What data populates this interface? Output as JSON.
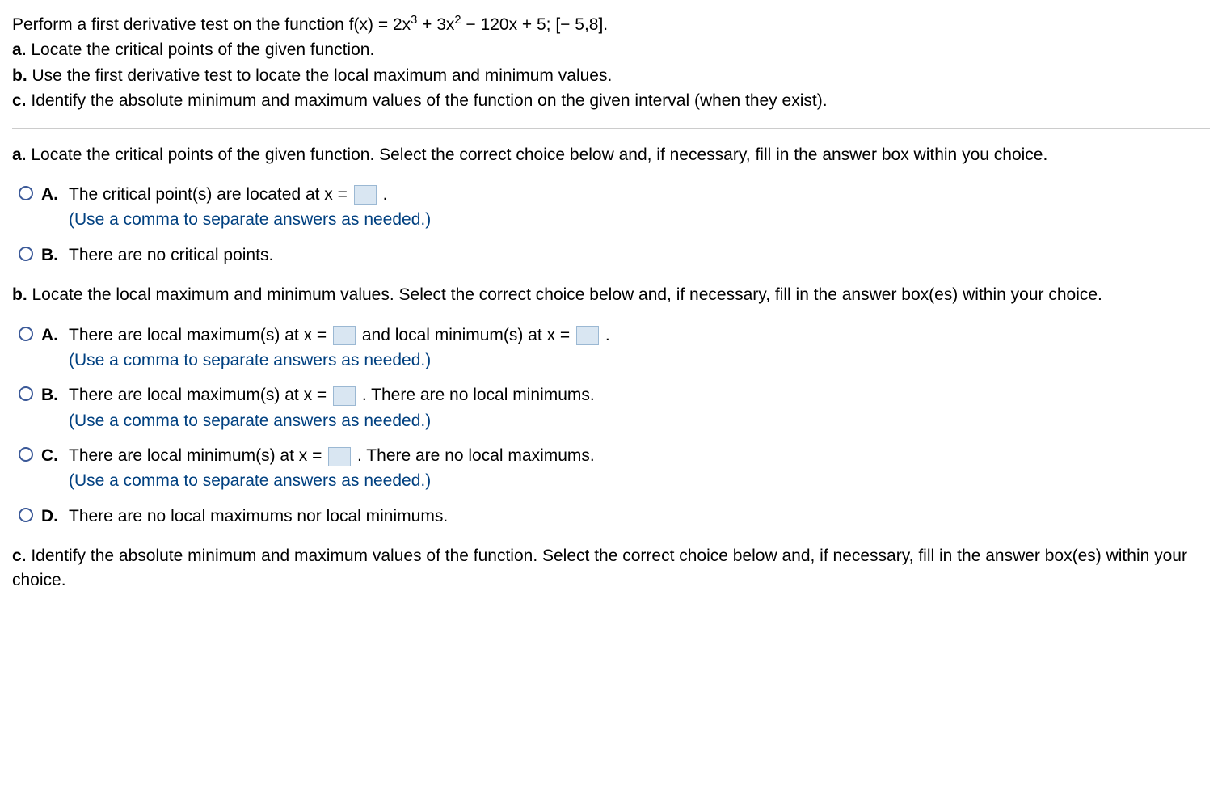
{
  "intro": {
    "main": "Perform a first derivative test on the function f(x) = 2x",
    "sup1": "3",
    "mid1": " + 3x",
    "sup2": "2",
    "mid2": " − 120x + 5; [− 5,8].",
    "a_label": "a.",
    "a_text": "Locate the critical points of the given function.",
    "b_label": "b.",
    "b_text": "Use the first derivative test to locate the local maximum and minimum values.",
    "c_label": "c.",
    "c_text": "Identify the absolute minimum and maximum values of the function on the given interval (when they exist)."
  },
  "part_a": {
    "prompt_label": "a.",
    "prompt_text": " Locate the critical points of the given function. Select the correct choice below and, if necessary, fill in the answer box within you choice.",
    "choices": {
      "A": {
        "letter": "A.",
        "text_before": "The critical point(s) are located at x = ",
        "text_after": " .",
        "hint": "(Use a comma to separate answers as needed.)"
      },
      "B": {
        "letter": "B.",
        "text": "There are no critical points."
      }
    }
  },
  "part_b": {
    "prompt_label": "b.",
    "prompt_text": " Locate the local maximum and minimum values. Select the correct choice below and, if necessary, fill in the answer box(es) within your choice.",
    "choices": {
      "A": {
        "letter": "A.",
        "text_before": "There are local maximum(s) at x = ",
        "text_mid": " and local minimum(s) at x = ",
        "text_after": " .",
        "hint": "(Use a comma to separate answers as needed.)"
      },
      "B": {
        "letter": "B.",
        "text_before": "There are local maximum(s) at x = ",
        "text_after": " . There are no local minimums.",
        "hint": "(Use a comma to separate answers as needed.)"
      },
      "C": {
        "letter": "C.",
        "text_before": "There are local minimum(s) at x = ",
        "text_after": " . There are no local maximums.",
        "hint": "(Use a comma to separate answers as needed.)"
      },
      "D": {
        "letter": "D.",
        "text": "There are no local maximums nor local minimums."
      }
    }
  },
  "part_c": {
    "prompt_label": "c.",
    "prompt_text": " Identify the absolute minimum and maximum values of the function. Select the correct choice below and, if necessary, fill in the answer box(es) within your choice."
  }
}
